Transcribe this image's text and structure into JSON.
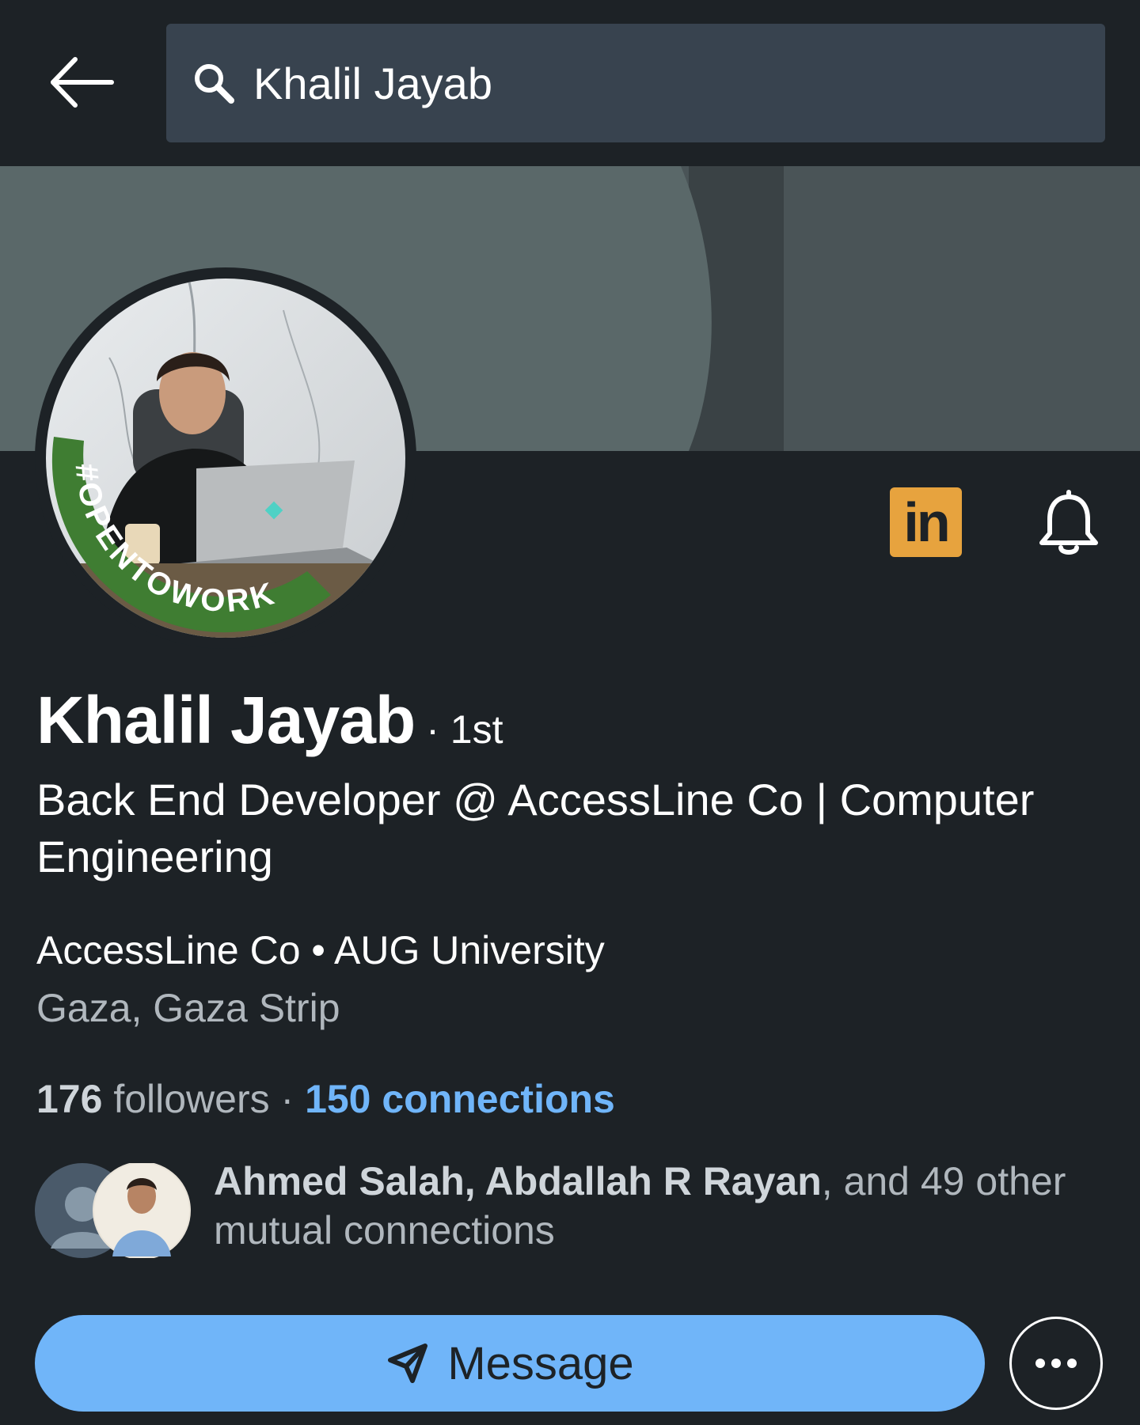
{
  "search": {
    "query": "Khalil Jayab"
  },
  "profile": {
    "name": "Khalil Jayab",
    "degree": "· 1st",
    "headline": "Back End Developer @ AccessLine Co | Computer Engineering",
    "company_line": "AccessLine Co • AUG University",
    "location": "Gaza, Gaza Strip",
    "frame_text": "#OPENTOWORK",
    "badge_label": "in"
  },
  "stats": {
    "followers_count": "176",
    "followers_label": " followers",
    "separator": " · ",
    "connections": "150 connections"
  },
  "mutual": {
    "names": "Ahmed Salah, Abdallah R Rayan",
    "rest": ", and 49 other mutual connections"
  },
  "actions": {
    "message_label": "Message"
  },
  "colors": {
    "background": "#1d2226",
    "search_bg": "#38434f",
    "accent_blue": "#70b5f9",
    "open_to_work_green": "#3f7d32",
    "linkedin_badge": "#e7a33e"
  },
  "icons": {
    "back": "arrow-left-icon",
    "search": "search-icon",
    "notify": "bell-icon",
    "message": "paper-plane-icon",
    "more": "more-horizontal-icon"
  }
}
